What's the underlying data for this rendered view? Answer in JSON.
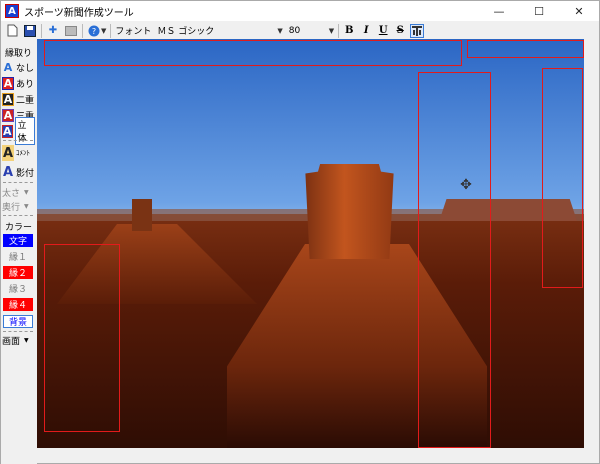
{
  "window": {
    "title": "スポーツ新聞作成ツール"
  },
  "window_controls": {
    "minimize": "—",
    "maximize": "☐",
    "close": "✕"
  },
  "toolbar": {
    "font_label": "フォント",
    "font_name": "ＭＳ ゴシック",
    "font_size": "80",
    "bold": "B",
    "italic": "I",
    "underline": "U",
    "strike": "S"
  },
  "sidebar": {
    "border_header": "縁取り",
    "items": [
      {
        "label": "なし",
        "glyph": "A"
      },
      {
        "label": "あり",
        "glyph": "A"
      },
      {
        "label": "二重",
        "glyph": "A"
      },
      {
        "label": "三重",
        "glyph": "A"
      },
      {
        "label": "立体",
        "glyph": "A"
      }
    ],
    "comment": {
      "label": "ｺﾒﾝﾄ",
      "glyph": "A"
    },
    "shadow": {
      "label": "影付",
      "glyph": "A"
    },
    "thickness": "太さ",
    "depth": "奥行",
    "color_header": "カラー",
    "colors": {
      "text": "文字",
      "edge1": "縁１",
      "edge2": "縁２",
      "edge3": "縁３",
      "edge4": "縁４",
      "background": "背景"
    },
    "screen": "画面"
  },
  "colors": {
    "accent_blue": "#0000ff",
    "red": "#ff0000",
    "selection_red": "#e21b1b"
  }
}
